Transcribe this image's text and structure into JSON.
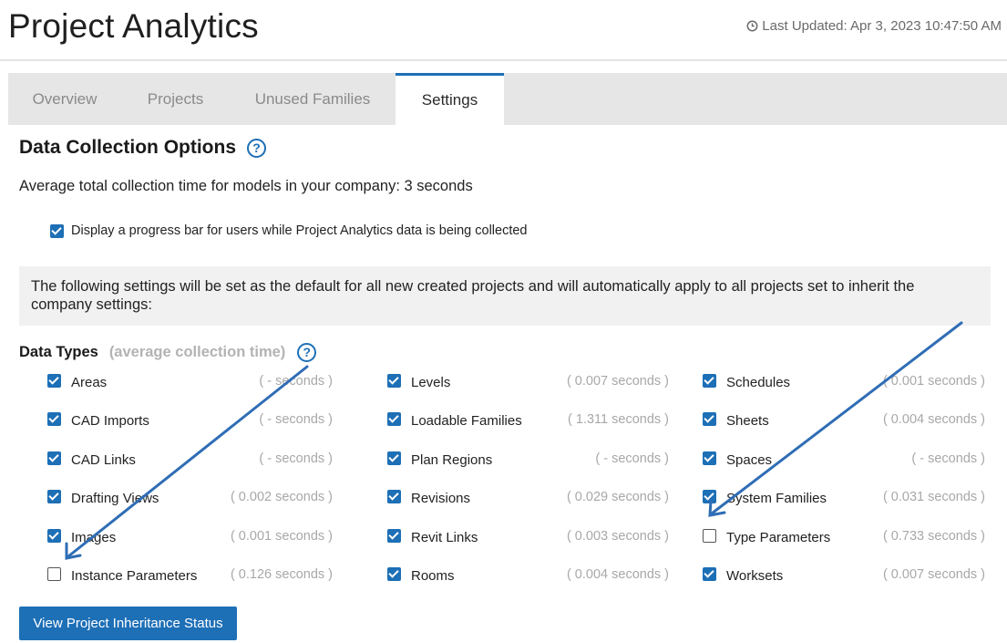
{
  "header": {
    "title": "Project Analytics",
    "last_updated": "Last Updated: Apr 3, 2023 10:47:50 AM"
  },
  "tabs": [
    {
      "label": "Overview",
      "active": false
    },
    {
      "label": "Projects",
      "active": false
    },
    {
      "label": "Unused Families",
      "active": false
    },
    {
      "label": "Settings",
      "active": true
    }
  ],
  "settings": {
    "section_title": "Data Collection Options",
    "help_glyph": "?",
    "avg_time": "Average total collection time for models in your company: 3 seconds",
    "progress_bar_label": "Display a progress bar for users while Project Analytics data is being collected",
    "progress_bar_checked": true,
    "info_text": "The following settings will be set as the default for all new created projects and will automatically apply to all projects set to inherit the company settings:",
    "data_types_title": "Data Types",
    "data_types_subtitle": "(average collection time)",
    "columns": [
      [
        {
          "label": "Areas",
          "time": "( - seconds )",
          "checked": true
        },
        {
          "label": "CAD Imports",
          "time": "( - seconds )",
          "checked": true
        },
        {
          "label": "CAD Links",
          "time": "( - seconds )",
          "checked": true
        },
        {
          "label": "Drafting Views",
          "time": "( 0.002 seconds )",
          "checked": true
        },
        {
          "label": "Images",
          "time": "( 0.001 seconds )",
          "checked": true
        },
        {
          "label": "Instance Parameters",
          "time": "( 0.126 seconds )",
          "checked": false
        }
      ],
      [
        {
          "label": "Levels",
          "time": "( 0.007 seconds )",
          "checked": true
        },
        {
          "label": "Loadable Families",
          "time": "( 1.311 seconds )",
          "checked": true
        },
        {
          "label": "Plan Regions",
          "time": "( - seconds )",
          "checked": true
        },
        {
          "label": "Revisions",
          "time": "( 0.029 seconds )",
          "checked": true
        },
        {
          "label": "Revit Links",
          "time": "( 0.003 seconds )",
          "checked": true
        },
        {
          "label": "Rooms",
          "time": "( 0.004 seconds )",
          "checked": true
        }
      ],
      [
        {
          "label": "Schedules",
          "time": "( 0.001 seconds )",
          "checked": true
        },
        {
          "label": "Sheets",
          "time": "( 0.004 seconds )",
          "checked": true
        },
        {
          "label": "Spaces",
          "time": "( - seconds )",
          "checked": true
        },
        {
          "label": "System Families",
          "time": "( 0.031 seconds )",
          "checked": true
        },
        {
          "label": "Type Parameters",
          "time": "( 0.733 seconds )",
          "checked": false
        },
        {
          "label": "Worksets",
          "time": "( 0.007 seconds )",
          "checked": true
        }
      ]
    ],
    "button_label": "View Project Inheritance Status"
  },
  "colors": {
    "accent": "#1d6fb6",
    "annotation_arrow": "#2f6db5"
  },
  "icons": {
    "clock": "clock-icon",
    "help": "help-icon"
  }
}
